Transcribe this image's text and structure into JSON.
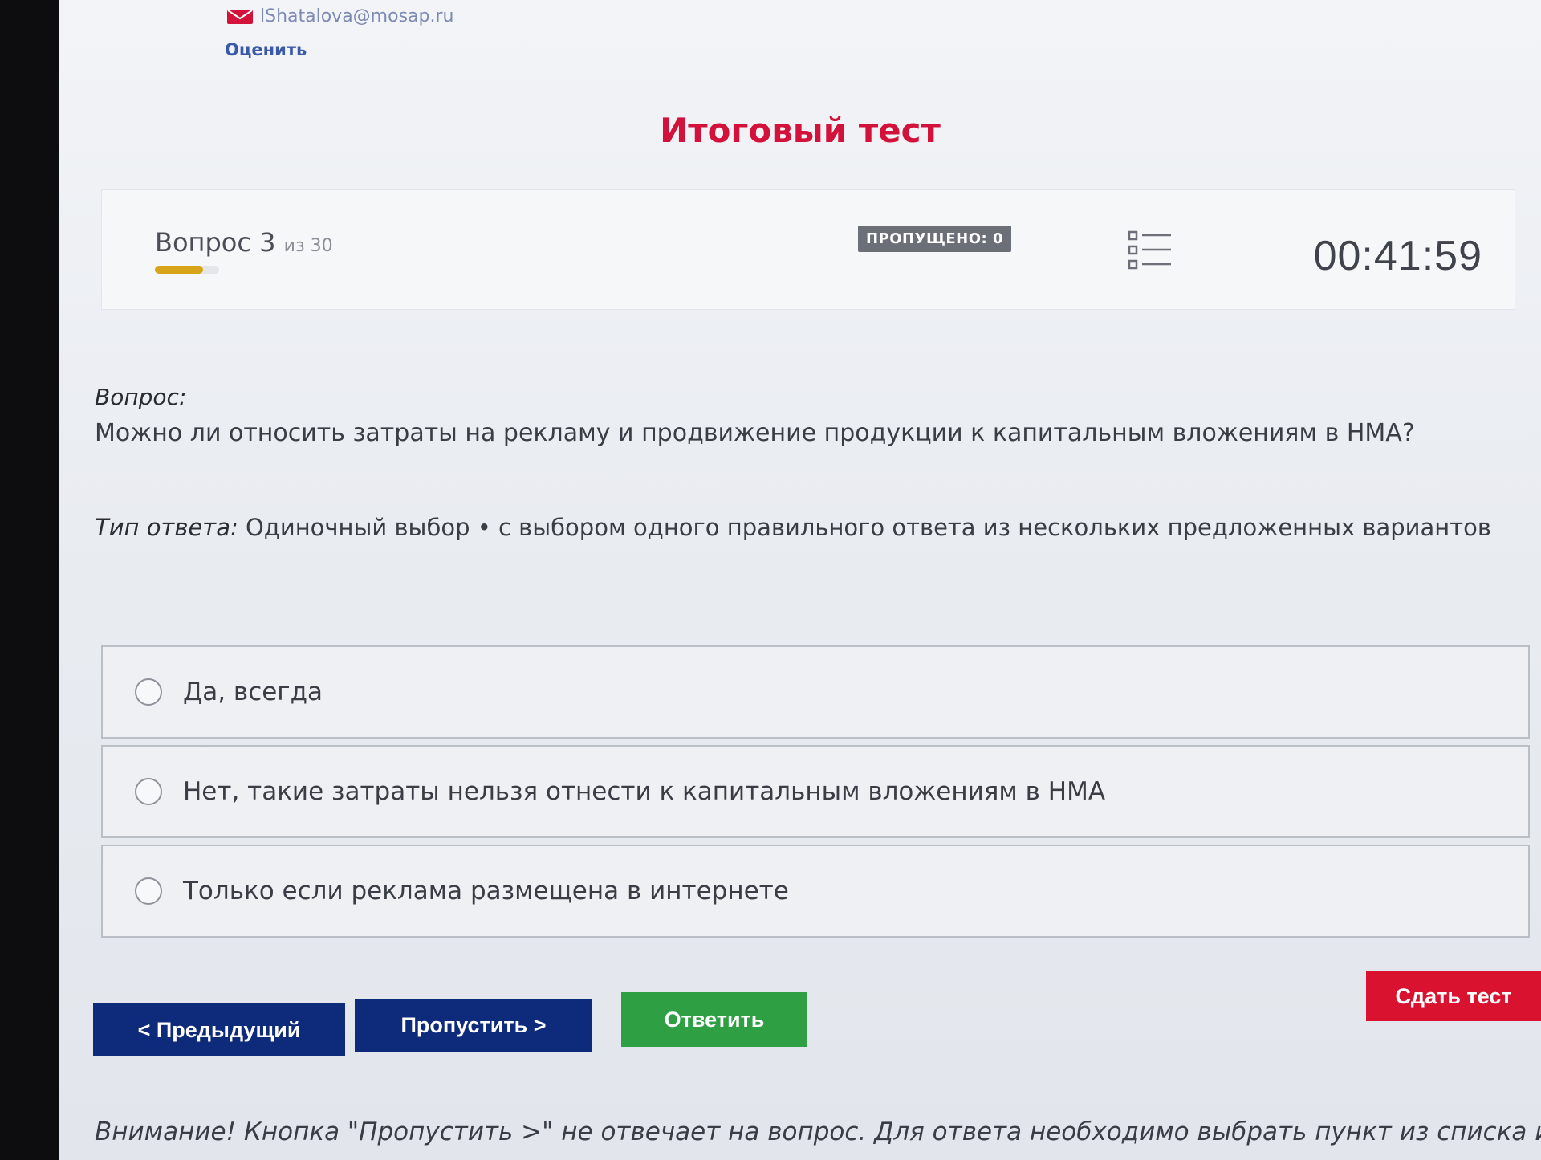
{
  "header": {
    "email": "lShatalova@mosap.ru",
    "rate_link": "Оценить"
  },
  "test": {
    "title": "Итоговый тест"
  },
  "progress": {
    "question_label": "Вопрос 3",
    "of_label": "из 30",
    "current": 3,
    "total": 30,
    "skipped_badge": "ПРОПУЩЕНО: 0",
    "timer": "00:41:59"
  },
  "question": {
    "label": "Вопрос:",
    "text": "Можно ли относить затраты на рекламу и продвижение продукции к капитальным вложениям в НМА?",
    "answer_type_label": "Тип ответа:",
    "answer_type": "Одиночный выбор • с выбором одного правильного ответа из нескольких предложенных вариантов"
  },
  "options": [
    {
      "label": "Да, всегда"
    },
    {
      "label": "Нет, такие затраты нельзя отнести к капитальным вложениям в НМА"
    },
    {
      "label": "Только если реклама размещена в интернете"
    }
  ],
  "buttons": {
    "prev": "< Предыдущий",
    "skip": "Пропустить >",
    "answer": "Ответить",
    "submit": "Сдать тест"
  },
  "footer": {
    "warning": "Внимание! Кнопка \"Пропустить >\" не отвечает на вопрос. Для ответа необходимо выбрать пункт из списка и нажать"
  },
  "colors": {
    "title_red": "#d2123a",
    "nav_blue": "#0e2a7a",
    "answer_green": "#2ea043",
    "submit_red": "#d9132f",
    "progress_gold": "#d8a51a"
  },
  "icons": {
    "mail": "envelope-icon",
    "list": "question-list-icon"
  }
}
